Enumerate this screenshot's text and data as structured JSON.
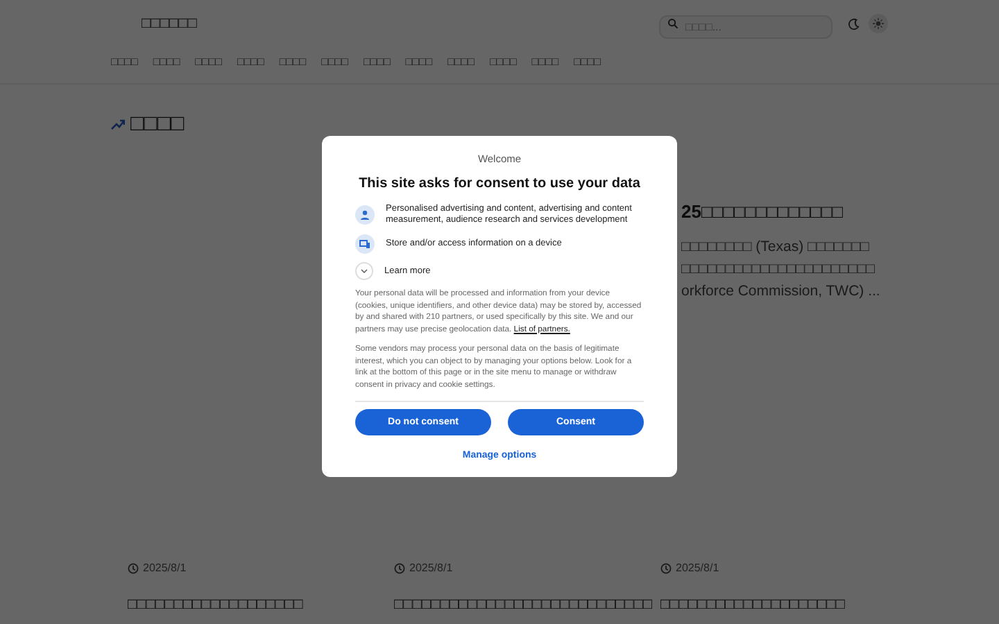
{
  "header": {
    "logo": "□□□□□□",
    "search": {
      "placeholder": "□□□□..."
    }
  },
  "nav": [
    "□□□□",
    "□□□□",
    "□□□□",
    "□□□□",
    "□□□□",
    "□□□□",
    "□□□□",
    "□□□□",
    "□□□□",
    "□□□□",
    "□□□□",
    "□□□□"
  ],
  "section": {
    "heading": "□□□□"
  },
  "featured": {
    "title": "25□□□□□□□□□□□□□",
    "lines": [
      "□□□□□□□□ (Texas) □□□□□□□",
      "□□□□□□□□□□□□□□□□□□□□□□",
      "orkforce Commission, TWC) ..."
    ]
  },
  "cards": [
    {
      "date": "2025/8/1",
      "title": "□□□□□□□□□□□□□□□□□□□"
    },
    {
      "date": "2025/8/1",
      "title": "□□□□□□□□□□□□□□□□□□□□□□□□□□□□"
    },
    {
      "date": "2025/8/1",
      "title": "□□□□□□□□□□□□□□□□□□□□"
    }
  ],
  "consent": {
    "eyebrow": "Welcome",
    "title": "This site asks for consent to use your data",
    "purposes": [
      {
        "kind": "person",
        "text": "Personalised advertising and content, advertising and content measurement, audience research and services development"
      },
      {
        "kind": "device",
        "text": "Store and/or access information on a device"
      }
    ],
    "learn_more": "Learn more",
    "paragraphs": [
      {
        "text": "Your personal data will be processed and information from your device (cookies, unique identifiers, and other device data) may be stored by, accessed by and shared with 210 partners, or used specifically by this site. We and our partners may use precise geolocation data.",
        "link": "List of partners."
      },
      {
        "text": "Some vendors may process your personal data on the basis of legitimate interest, which you can object to by managing your options below. Look for a link at the bottom of this page or in the site menu to manage or withdraw consent in privacy and cookie settings."
      }
    ],
    "buttons": [
      "Do not consent",
      "Consent"
    ],
    "manage": "Manage options"
  }
}
